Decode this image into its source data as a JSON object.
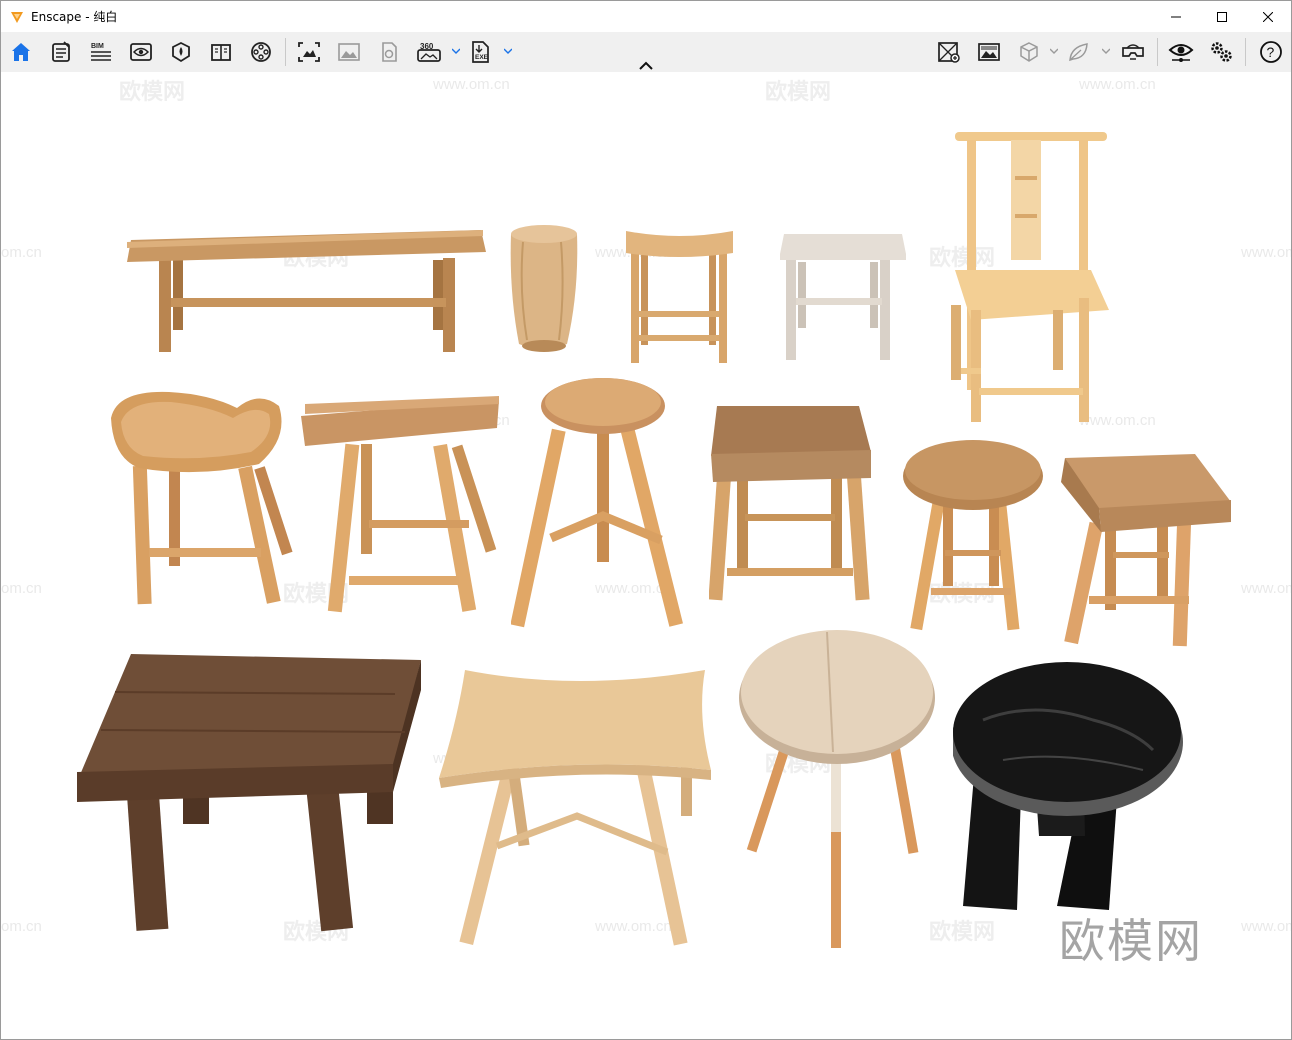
{
  "window": {
    "title": "Enscape - 纯白",
    "app_icon": "enscape-logo-icon",
    "controls": [
      "minimize-icon",
      "maximize-icon",
      "close-icon"
    ]
  },
  "toolbar": {
    "left_icons": [
      "home-icon",
      "notes-icon",
      "bim-icon",
      "view-eye-icon",
      "material-icon",
      "book-icon",
      "video-reel-icon"
    ],
    "bim_label": "BIM",
    "middle_icons": [
      "screenshot-icon",
      "image-gallery-icon",
      "batch-render-icon",
      "panorama-360-icon",
      "exe-export-icon"
    ],
    "panorama_label": "360",
    "exe_label": "EXE",
    "right_icons": [
      "asset-library-icon",
      "atmosphere-icon",
      "cube-view-icon",
      "leaf-icon",
      "vr-headset-icon",
      "visual-settings-eye-icon",
      "settings-gears-icon",
      "help-icon"
    ],
    "help_label": "?"
  },
  "viewport": {
    "watermark_logo": "欧模网",
    "watermark_url": "www.om.cn",
    "watermark_partial": "om.cn",
    "furniture": [
      "long-bench",
      "drum-stool",
      "saddle-stool",
      "white-stool",
      "ming-style-chair",
      "saddle-seat-stool",
      "rectangular-stool",
      "round-tripod-stool",
      "square-stool",
      "small-round-stool",
      "square-top-stool",
      "rustic-dark-bench",
      "curved-bench",
      "round-side-table",
      "black-round-stool"
    ]
  },
  "colors": {
    "home_active": "#1a73e8",
    "toolbar_bg": "#f0f0f0",
    "wood_light": "#d9a86b",
    "wood_mid": "#b98550",
    "wood_dark": "#6b4a33",
    "black_wood": "#141414"
  }
}
